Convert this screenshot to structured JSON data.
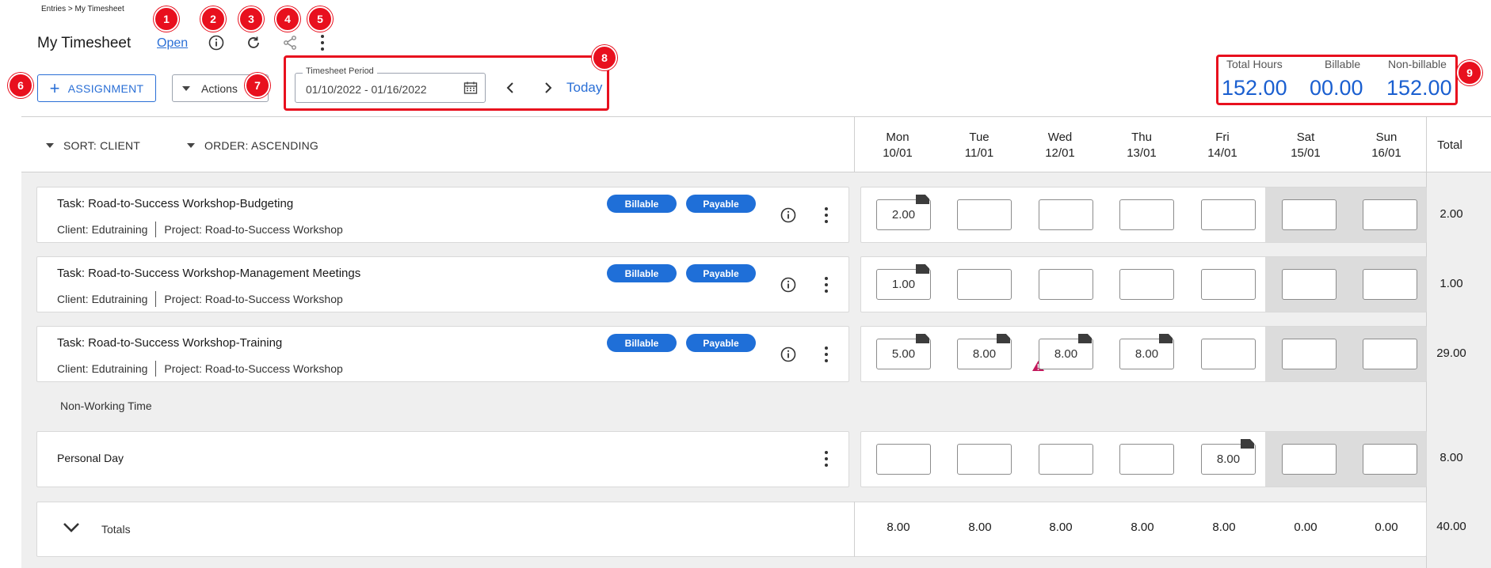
{
  "breadcrumb": "Entries > My Timesheet",
  "page_title": "My Timesheet",
  "status_link": "Open",
  "toolbar": {
    "assignment_label": "ASSIGNMENT",
    "actions_label": "Actions",
    "period_legend": "Timesheet Period",
    "period_value": "01/10/2022 - 01/16/2022",
    "today_label": "Today"
  },
  "summary": {
    "total_label": "Total Hours",
    "total_value": "152.00",
    "billable_label": "Billable",
    "billable_value": "00.00",
    "nonbillable_label": "Non-billable",
    "nonbillable_value": "152.00"
  },
  "badges": [
    "1",
    "2",
    "3",
    "4",
    "5",
    "6",
    "7",
    "8",
    "9"
  ],
  "sort": {
    "sort_label": "SORT: CLIENT",
    "order_label": "ORDER: ASCENDING"
  },
  "days": [
    {
      "name": "Mon",
      "date": "10/01"
    },
    {
      "name": "Tue",
      "date": "11/01"
    },
    {
      "name": "Wed",
      "date": "12/01"
    },
    {
      "name": "Thu",
      "date": "13/01"
    },
    {
      "name": "Fri",
      "date": "14/01"
    },
    {
      "name": "Sat",
      "date": "15/01"
    },
    {
      "name": "Sun",
      "date": "16/01"
    }
  ],
  "total_header": "Total",
  "tasks": [
    {
      "title": "Task: Road-to-Success Workshop-Budgeting",
      "client": "Client: Edutraining",
      "project": "Project: Road-to-Success Workshop",
      "tag1": "Billable",
      "tag2": "Payable",
      "hours": [
        "2.00",
        "",
        "",
        "",
        "",
        "",
        ""
      ],
      "total": "2.00"
    },
    {
      "title": "Task: Road-to-Success Workshop-Management Meetings",
      "client": "Client: Edutraining",
      "project": "Project: Road-to-Success Workshop",
      "tag1": "Billable",
      "tag2": "Payable",
      "hours": [
        "1.00",
        "",
        "",
        "",
        "",
        "",
        ""
      ],
      "total": "1.00"
    },
    {
      "title": "Task: Road-to-Success Workshop-Training",
      "client": "Client: Edutraining",
      "project": "Project: Road-to-Success Workshop",
      "tag1": "Billable",
      "tag2": "Payable",
      "hours": [
        "5.00",
        "8.00",
        "8.00",
        "8.00",
        "",
        "",
        ""
      ],
      "total": "29.00"
    }
  ],
  "non_working": {
    "section_label": "Non-Working Time",
    "title": "Personal Day",
    "hours": [
      "",
      "",
      "",
      "",
      "8.00",
      "",
      ""
    ],
    "total": "8.00"
  },
  "totals": {
    "label": "Totals",
    "values": [
      "8.00",
      "8.00",
      "8.00",
      "8.00",
      "8.00",
      "0.00",
      "0.00"
    ],
    "grand_total": "40.00"
  },
  "colors": {
    "accent": "#1f6fd8",
    "badge": "#e8101e",
    "weekend": "#dcdcdc"
  }
}
